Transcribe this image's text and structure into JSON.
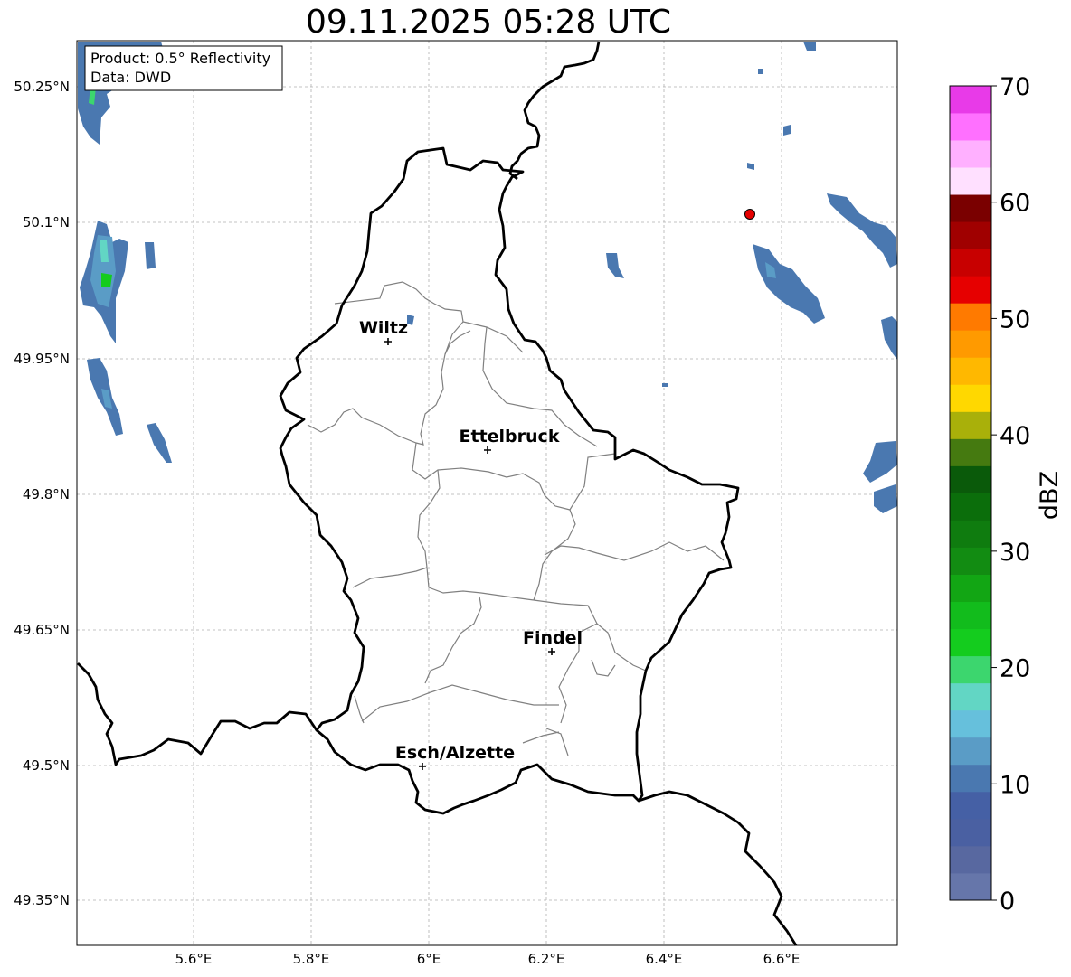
{
  "title": "09.11.2025 05:28 UTC",
  "info": {
    "product": "Product: 0.5° Reflectivity",
    "source": "Data: DWD"
  },
  "axes": {
    "lat_ticks": [
      "50.25°N",
      "50.1°N",
      "49.95°N",
      "49.8°N",
      "49.65°N",
      "49.5°N",
      "49.35°N"
    ],
    "lon_ticks": [
      "5.6°E",
      "5.8°E",
      "6°E",
      "6.2°E",
      "6.4°E",
      "6.6°E"
    ],
    "grid": true
  },
  "cities": [
    {
      "name": "Wiltz"
    },
    {
      "name": "Ettelbruck"
    },
    {
      "name": "Findel"
    },
    {
      "name": "Esch/Alzette"
    }
  ],
  "colorbar": {
    "label": "dBZ",
    "ticks": [
      "0",
      "10",
      "20",
      "30",
      "40",
      "50",
      "60",
      "70"
    ],
    "colors": [
      "#6676aa",
      "#5868a0",
      "#4a60a2",
      "#4560a5",
      "#4a78b0",
      "#5a9cc6",
      "#66c0dc",
      "#62d6c4",
      "#3cd66e",
      "#14cc1e",
      "#12bc1c",
      "#12a614",
      "#128c12",
      "#0f7c0f",
      "#0b6e0b",
      "#0a5a0a",
      "#457a10",
      "#a9b00a",
      "#ffd800",
      "#ffb800",
      "#ff9a00",
      "#ff7a00",
      "#e60000",
      "#c80000",
      "#a00000",
      "#7a0000",
      "#ffe0ff",
      "#ffb0ff",
      "#ff70ff",
      "#e83ae8"
    ]
  },
  "radar_site": {
    "color": "#e60000"
  },
  "colors": {
    "border": "#000000",
    "canton": "#808080",
    "grid": "#b0b0b0"
  }
}
